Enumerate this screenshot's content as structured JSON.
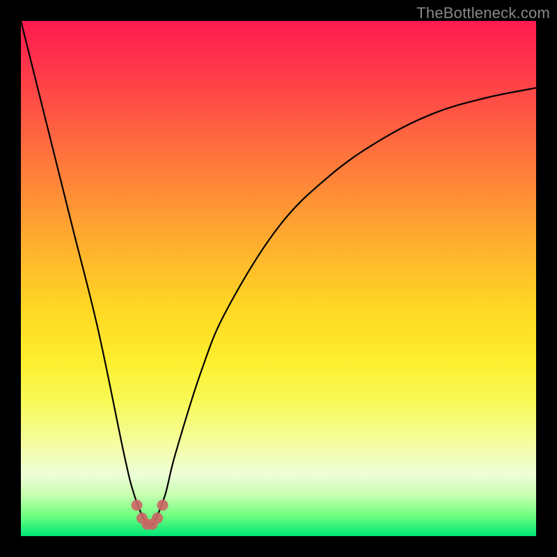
{
  "watermark": "TheBottleneck.com",
  "colors": {
    "frame": "#000000",
    "curve_stroke": "#000000",
    "marker_fill": "#cc6666",
    "gradient_top": "#ff1a50",
    "gradient_bottom": "#00e676"
  },
  "chart_data": {
    "type": "line",
    "title": "",
    "xlabel": "",
    "ylabel": "",
    "xlim": [
      0,
      100
    ],
    "ylim": [
      0,
      100
    ],
    "grid": false,
    "legend": false,
    "annotations": [
      "TheBottleneck.com"
    ],
    "note": "Bottleneck-style V-curve. y decreases steeply from (0,100) to a minimum near x≈25, then rises concavely toward x=100. Markers cluster near the trough.",
    "series": [
      {
        "name": "curve",
        "x": [
          0,
          5,
          10,
          15,
          20,
          22,
          24,
          25,
          26,
          28,
          30,
          35,
          40,
          50,
          60,
          70,
          80,
          90,
          100
        ],
        "y": [
          100,
          80,
          60,
          40,
          16,
          8,
          3,
          2,
          3,
          8,
          16,
          32,
          44,
          60,
          70,
          77,
          82,
          85,
          87
        ]
      }
    ],
    "markers": {
      "name": "trough-markers",
      "x": [
        22.5,
        23.5,
        24.5,
        25.5,
        26.5,
        27.5
      ],
      "y": [
        6,
        3.5,
        2.3,
        2.3,
        3.5,
        6
      ]
    }
  }
}
